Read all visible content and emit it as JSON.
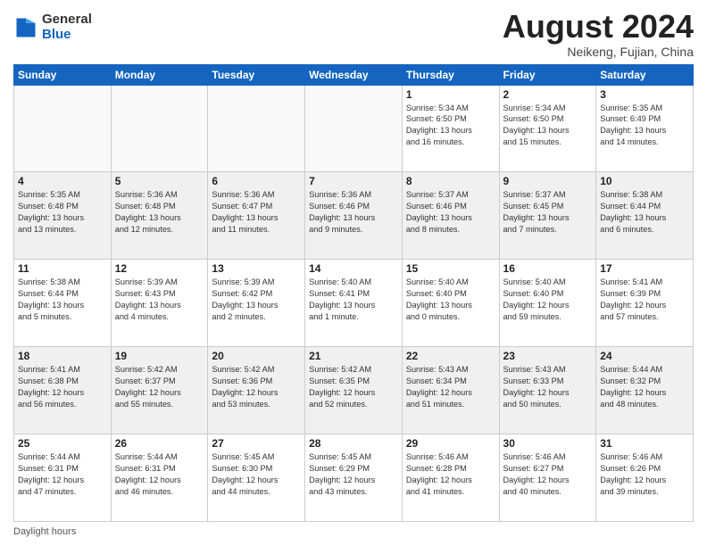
{
  "header": {
    "logo_general": "General",
    "logo_blue": "Blue",
    "month_title": "August 2024",
    "location": "Neikeng, Fujian, China"
  },
  "days_of_week": [
    "Sunday",
    "Monday",
    "Tuesday",
    "Wednesday",
    "Thursday",
    "Friday",
    "Saturday"
  ],
  "weeks": [
    [
      {
        "day": "",
        "info": ""
      },
      {
        "day": "",
        "info": ""
      },
      {
        "day": "",
        "info": ""
      },
      {
        "day": "",
        "info": ""
      },
      {
        "day": "1",
        "info": "Sunrise: 5:34 AM\nSunset: 6:50 PM\nDaylight: 13 hours\nand 16 minutes."
      },
      {
        "day": "2",
        "info": "Sunrise: 5:34 AM\nSunset: 6:50 PM\nDaylight: 13 hours\nand 15 minutes."
      },
      {
        "day": "3",
        "info": "Sunrise: 5:35 AM\nSunset: 6:49 PM\nDaylight: 13 hours\nand 14 minutes."
      }
    ],
    [
      {
        "day": "4",
        "info": "Sunrise: 5:35 AM\nSunset: 6:48 PM\nDaylight: 13 hours\nand 13 minutes."
      },
      {
        "day": "5",
        "info": "Sunrise: 5:36 AM\nSunset: 6:48 PM\nDaylight: 13 hours\nand 12 minutes."
      },
      {
        "day": "6",
        "info": "Sunrise: 5:36 AM\nSunset: 6:47 PM\nDaylight: 13 hours\nand 11 minutes."
      },
      {
        "day": "7",
        "info": "Sunrise: 5:36 AM\nSunset: 6:46 PM\nDaylight: 13 hours\nand 9 minutes."
      },
      {
        "day": "8",
        "info": "Sunrise: 5:37 AM\nSunset: 6:46 PM\nDaylight: 13 hours\nand 8 minutes."
      },
      {
        "day": "9",
        "info": "Sunrise: 5:37 AM\nSunset: 6:45 PM\nDaylight: 13 hours\nand 7 minutes."
      },
      {
        "day": "10",
        "info": "Sunrise: 5:38 AM\nSunset: 6:44 PM\nDaylight: 13 hours\nand 6 minutes."
      }
    ],
    [
      {
        "day": "11",
        "info": "Sunrise: 5:38 AM\nSunset: 6:44 PM\nDaylight: 13 hours\nand 5 minutes."
      },
      {
        "day": "12",
        "info": "Sunrise: 5:39 AM\nSunset: 6:43 PM\nDaylight: 13 hours\nand 4 minutes."
      },
      {
        "day": "13",
        "info": "Sunrise: 5:39 AM\nSunset: 6:42 PM\nDaylight: 13 hours\nand 2 minutes."
      },
      {
        "day": "14",
        "info": "Sunrise: 5:40 AM\nSunset: 6:41 PM\nDaylight: 13 hours\nand 1 minute."
      },
      {
        "day": "15",
        "info": "Sunrise: 5:40 AM\nSunset: 6:40 PM\nDaylight: 13 hours\nand 0 minutes."
      },
      {
        "day": "16",
        "info": "Sunrise: 5:40 AM\nSunset: 6:40 PM\nDaylight: 12 hours\nand 59 minutes."
      },
      {
        "day": "17",
        "info": "Sunrise: 5:41 AM\nSunset: 6:39 PM\nDaylight: 12 hours\nand 57 minutes."
      }
    ],
    [
      {
        "day": "18",
        "info": "Sunrise: 5:41 AM\nSunset: 6:38 PM\nDaylight: 12 hours\nand 56 minutes."
      },
      {
        "day": "19",
        "info": "Sunrise: 5:42 AM\nSunset: 6:37 PM\nDaylight: 12 hours\nand 55 minutes."
      },
      {
        "day": "20",
        "info": "Sunrise: 5:42 AM\nSunset: 6:36 PM\nDaylight: 12 hours\nand 53 minutes."
      },
      {
        "day": "21",
        "info": "Sunrise: 5:42 AM\nSunset: 6:35 PM\nDaylight: 12 hours\nand 52 minutes."
      },
      {
        "day": "22",
        "info": "Sunrise: 5:43 AM\nSunset: 6:34 PM\nDaylight: 12 hours\nand 51 minutes."
      },
      {
        "day": "23",
        "info": "Sunrise: 5:43 AM\nSunset: 6:33 PM\nDaylight: 12 hours\nand 50 minutes."
      },
      {
        "day": "24",
        "info": "Sunrise: 5:44 AM\nSunset: 6:32 PM\nDaylight: 12 hours\nand 48 minutes."
      }
    ],
    [
      {
        "day": "25",
        "info": "Sunrise: 5:44 AM\nSunset: 6:31 PM\nDaylight: 12 hours\nand 47 minutes."
      },
      {
        "day": "26",
        "info": "Sunrise: 5:44 AM\nSunset: 6:31 PM\nDaylight: 12 hours\nand 46 minutes."
      },
      {
        "day": "27",
        "info": "Sunrise: 5:45 AM\nSunset: 6:30 PM\nDaylight: 12 hours\nand 44 minutes."
      },
      {
        "day": "28",
        "info": "Sunrise: 5:45 AM\nSunset: 6:29 PM\nDaylight: 12 hours\nand 43 minutes."
      },
      {
        "day": "29",
        "info": "Sunrise: 5:46 AM\nSunset: 6:28 PM\nDaylight: 12 hours\nand 41 minutes."
      },
      {
        "day": "30",
        "info": "Sunrise: 5:46 AM\nSunset: 6:27 PM\nDaylight: 12 hours\nand 40 minutes."
      },
      {
        "day": "31",
        "info": "Sunrise: 5:46 AM\nSunset: 6:26 PM\nDaylight: 12 hours\nand 39 minutes."
      }
    ]
  ],
  "footer": {
    "daylight_label": "Daylight hours"
  }
}
